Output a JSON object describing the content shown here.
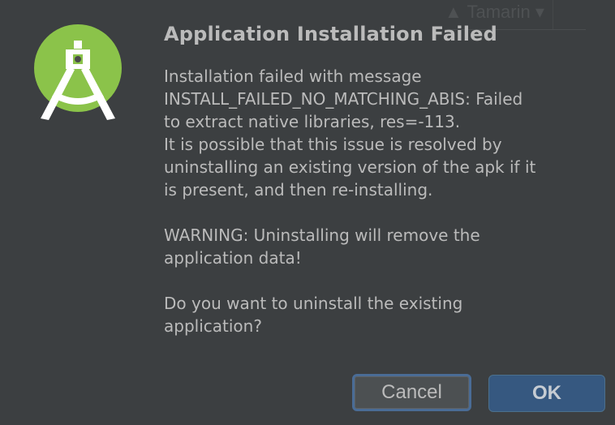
{
  "background": {
    "text": "Tamarin"
  },
  "dialog": {
    "title": "Application Installation Failed",
    "message_lines": [
      "Installation failed with message",
      "INSTALL_FAILED_NO_MATCHING_ABIS: Failed",
      "to extract native libraries, res=-113.",
      "It is possible that this issue is resolved by",
      "uninstalling an existing version of the apk if it",
      "is present, and then re-installing."
    ],
    "warning_lines": [
      "WARNING: Uninstalling will remove the",
      "application data!"
    ],
    "question_lines": [
      "Do you want to uninstall the existing",
      "application?"
    ],
    "icon": "android-studio-icon",
    "cancel_label": "Cancel",
    "ok_label": "OK"
  },
  "colors": {
    "background": "#3c3f41",
    "text": "#bbbbbb",
    "icon_green": "#8bc34a",
    "ok_button": "#365880",
    "focus_ring": "#4a6c96"
  }
}
